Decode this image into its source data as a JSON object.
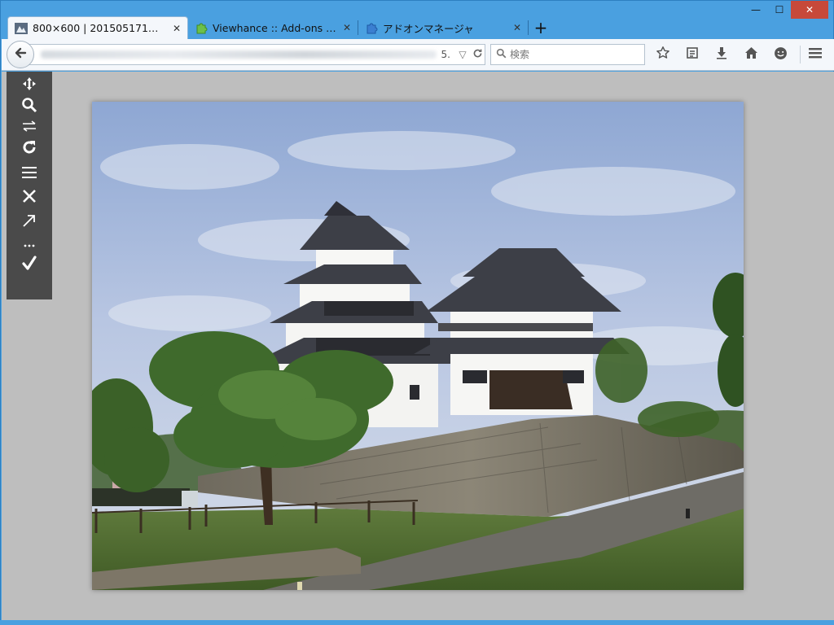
{
  "window": {
    "minimize_glyph": "—",
    "maximize_glyph": "☐",
    "close_glyph": "✕"
  },
  "tabs": [
    {
      "label": "800×600 | 201505171…",
      "icon": "image-favicon-icon",
      "active": true
    },
    {
      "label": "Viewhance :: Add-ons f…",
      "icon": "puzzle-green-icon",
      "active": false
    },
    {
      "label": "アドオンマネージャ",
      "icon": "puzzle-blue-icon",
      "active": false
    }
  ],
  "newtab_glyph": "+",
  "tab_close_glyph": "✕",
  "navbar": {
    "url_tail": "5.",
    "search_placeholder": "検索",
    "buttons": [
      "star-icon",
      "reading-list-icon",
      "download-icon",
      "home-icon",
      "smiley-icon",
      "hamburger-menu-icon"
    ]
  },
  "viewer_toolbar": [
    {
      "name": "move-icon",
      "glyph": "✥"
    },
    {
      "name": "zoom-icon",
      "glyph": "🔍"
    },
    {
      "name": "flip-icon",
      "glyph": "⇋"
    },
    {
      "name": "rotate-icon",
      "glyph": "↻"
    },
    {
      "name": "menu-icon",
      "glyph": "☰"
    },
    {
      "name": "close-icon",
      "glyph": "✕"
    },
    {
      "name": "open-icon",
      "glyph": "↗"
    },
    {
      "name": "more-icon",
      "glyph": "⋯"
    },
    {
      "name": "check-icon",
      "glyph": "✔"
    }
  ],
  "colors": {
    "frame": "#4aa0e0",
    "toolbar": "#f4f7fb",
    "content_bg": "#bebebe",
    "viewer_toolbar": "#4a4a4a",
    "close_button": "#c7493a"
  }
}
